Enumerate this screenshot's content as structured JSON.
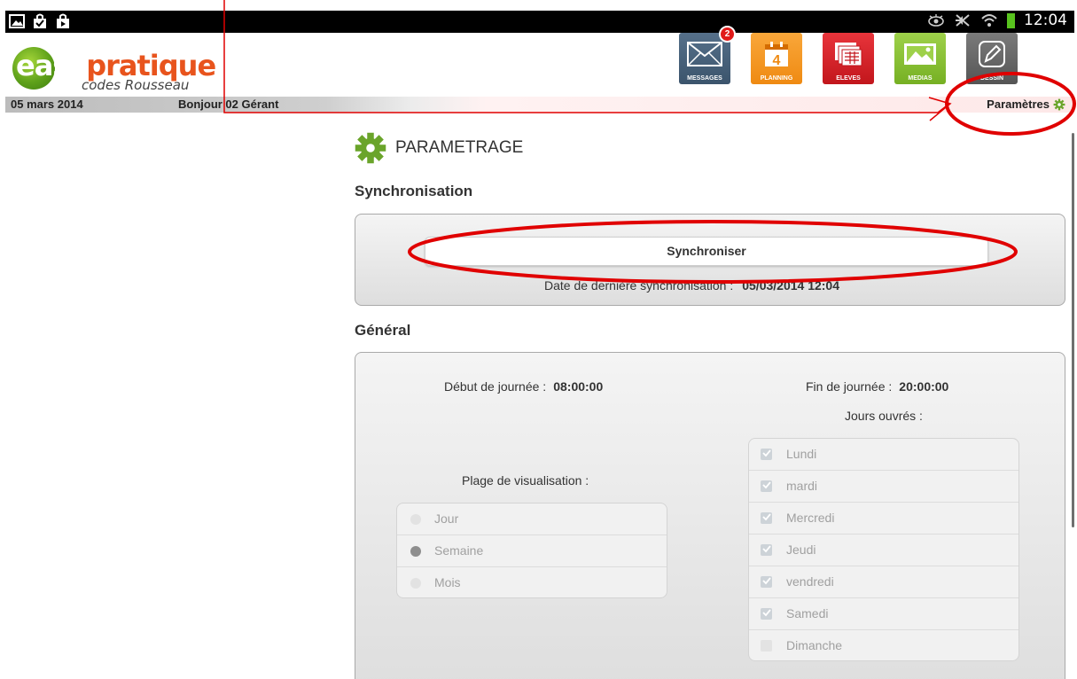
{
  "status_bar": {
    "time": "12:04",
    "left_icons": [
      "gallery-icon",
      "shopping-bag-icon",
      "store-icon"
    ],
    "right_icons": [
      "eye-icon",
      "mute-icon",
      "wifi-icon",
      "battery-icon"
    ]
  },
  "header": {
    "logo": {
      "easy": "easy",
      "pratique": "pratique",
      "tagline": "codes Rousseau"
    },
    "tiles": [
      {
        "id": "messages",
        "label": "MESSAGES",
        "badge": "2",
        "icon": "envelope-icon"
      },
      {
        "id": "planning",
        "label": "PLANNING",
        "day": "4",
        "icon": "calendar-icon"
      },
      {
        "id": "eleves",
        "label": "ELEVES",
        "icon": "students-icon"
      },
      {
        "id": "medias",
        "label": "MEDIAS",
        "icon": "image-icon"
      },
      {
        "id": "dessin",
        "label": "DESSIN",
        "icon": "pencil-icon"
      }
    ]
  },
  "info_bar": {
    "date": "05 mars 2014",
    "greeting": "Bonjour 02 Gérant",
    "settings_link": "Paramètres"
  },
  "page": {
    "title": "PARAMETRAGE",
    "sync_section": {
      "heading": "Synchronisation",
      "button": "Synchroniser",
      "last_sync_label": "Date de dernière synchronisation :",
      "last_sync_value": "05/03/2014 12:04"
    },
    "general_section": {
      "heading": "Général",
      "start_label": "Début de journée :",
      "start_value": "08:00:00",
      "end_label": "Fin de journée :",
      "end_value": "20:00:00",
      "working_days_label": "Jours ouvrés :",
      "view_range_label": "Plage de visualisation :",
      "view_range_options": [
        {
          "label": "Jour",
          "selected": false
        },
        {
          "label": "Semaine",
          "selected": true
        },
        {
          "label": "Mois",
          "selected": false
        }
      ],
      "days": [
        {
          "label": "Lundi",
          "checked": true
        },
        {
          "label": "mardi",
          "checked": true
        },
        {
          "label": "Mercredi",
          "checked": true
        },
        {
          "label": "Jeudi",
          "checked": true
        },
        {
          "label": "vendredi",
          "checked": true
        },
        {
          "label": "Samedi",
          "checked": true
        },
        {
          "label": "Dimanche",
          "checked": false
        }
      ]
    }
  },
  "colors": {
    "accent_green": "#6aa42a",
    "annotation_red": "#e00000"
  }
}
